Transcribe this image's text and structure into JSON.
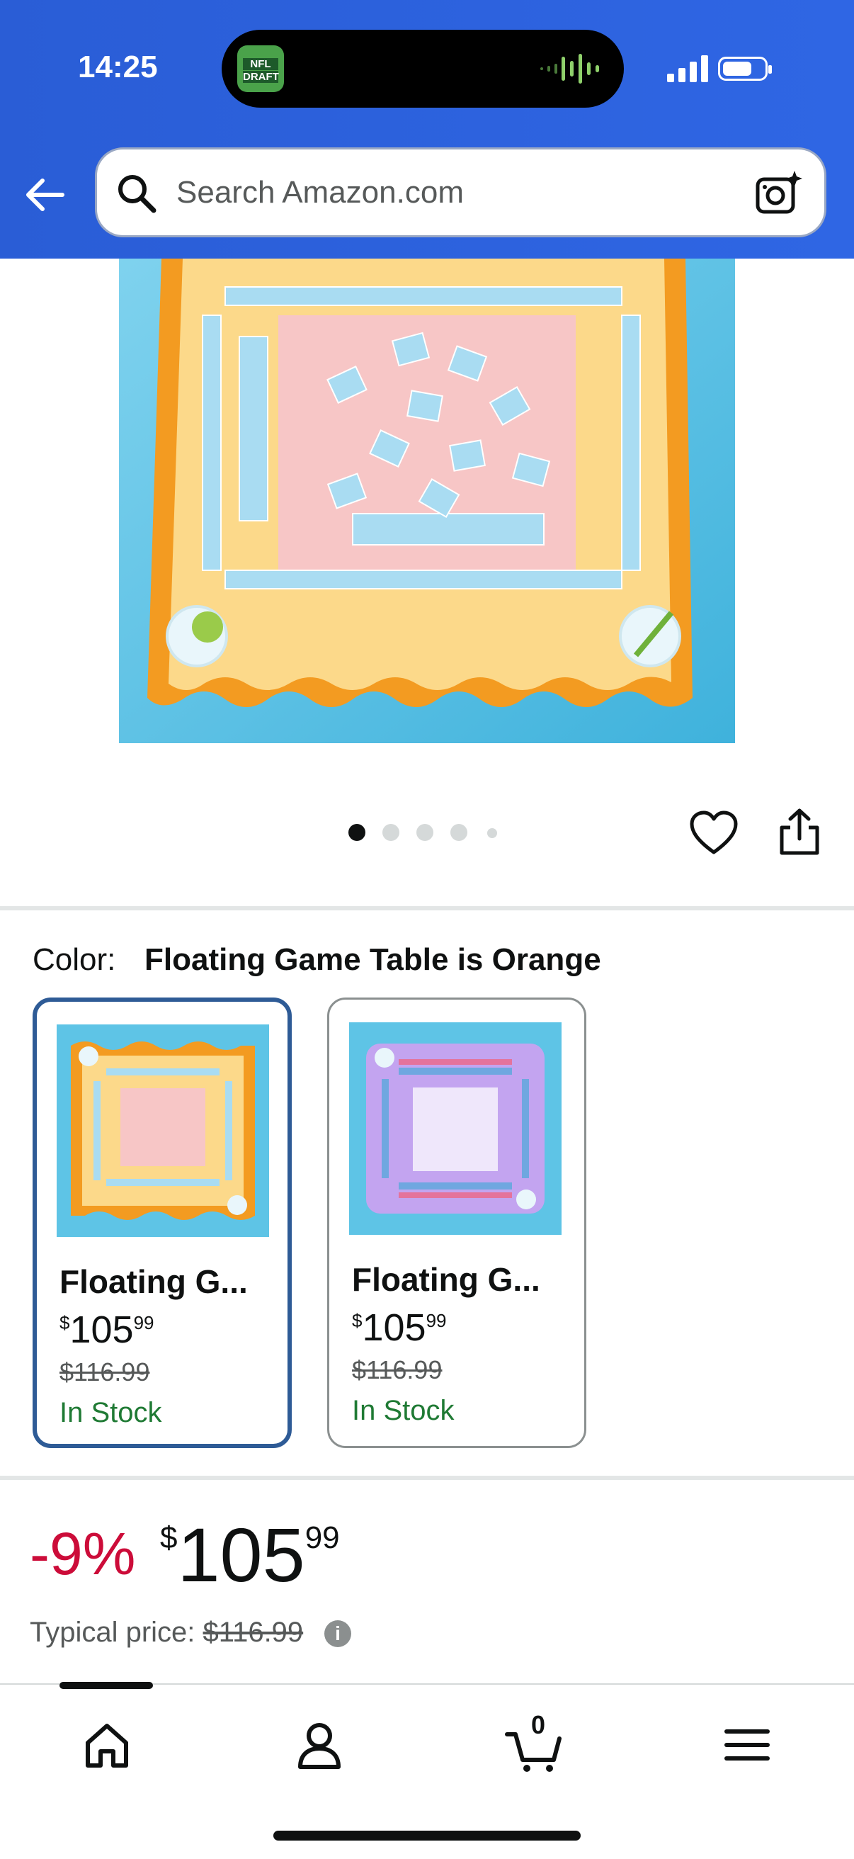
{
  "status_bar": {
    "time": "14:25",
    "app_badge_line1": "NFL",
    "app_badge_line2": "DRAFT"
  },
  "search": {
    "placeholder": "Search Amazon.com"
  },
  "gallery": {
    "image_count": 5,
    "current_index": 0
  },
  "color_selector": {
    "label": "Color:",
    "selected_value": "Floating Game Table is Orange",
    "options": [
      {
        "name": "Floating G...",
        "price_whole": "105",
        "price_fraction": "99",
        "currency": "$",
        "list_price": "$116.99",
        "availability": "In Stock",
        "selected": true
      },
      {
        "name": "Floating G...",
        "price_whole": "105",
        "price_fraction": "99",
        "currency": "$",
        "list_price": "$116.99",
        "availability": "In Stock",
        "selected": false
      }
    ]
  },
  "pricing": {
    "discount": "-9%",
    "currency": "$",
    "price_whole": "105",
    "price_fraction": "99",
    "typical_label": "Typical price:",
    "typical_value": "$116.99"
  },
  "tab_bar": {
    "cart_count": "0"
  },
  "colors": {
    "header_blue": "#2f66e4",
    "discount_red": "#cc0c39",
    "in_stock_green": "#1f7a34",
    "selected_border": "#2e5b96",
    "orange_table": "#f6a623",
    "pool_blue": "#5ec4e6"
  },
  "icons": [
    "back-arrow-icon",
    "search-icon",
    "camera-icon",
    "heart-icon",
    "share-icon",
    "info-icon",
    "home-icon",
    "account-icon",
    "cart-icon",
    "menu-icon"
  ]
}
